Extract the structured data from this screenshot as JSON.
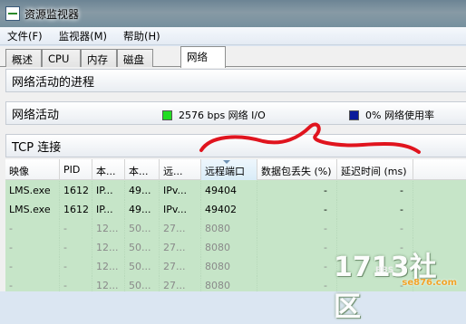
{
  "window": {
    "title": "资源监视器"
  },
  "menu": [
    {
      "label": "文件(F)"
    },
    {
      "label": "监视器(M)"
    },
    {
      "label": "帮助(H)"
    }
  ],
  "tabs": [
    {
      "label": "概述"
    },
    {
      "label": "CPU"
    },
    {
      "label": "内存"
    },
    {
      "label": "磁盘"
    },
    {
      "label": "网络",
      "active": true
    }
  ],
  "sections": {
    "processes": {
      "title": "网络活动的进程"
    },
    "activity": {
      "title": "网络活动",
      "io_legend": "2576 bps 网络 I/O",
      "usage_legend": "0% 网络使用率",
      "io_color": "#22dd22",
      "usage_color": "#0a1a9a"
    },
    "tcp": {
      "title": "TCP 连接"
    }
  },
  "tcp_table": {
    "columns": [
      "映像",
      "PID",
      "本...",
      "本...",
      "远...",
      "远程端口",
      "数据包丢失 (%)",
      "延迟时间 (ms)"
    ],
    "sorted_column": "远程端口",
    "rows": [
      [
        "LMS.exe",
        "1612",
        "IP...",
        "49...",
        "IPv...",
        "49404",
        "-",
        "-"
      ],
      [
        "LMS.exe",
        "1612",
        "IP...",
        "49...",
        "IPv...",
        "49402",
        "-",
        "-"
      ],
      [
        "-",
        "-",
        "12...",
        "50...",
        "27...",
        "8080",
        "-",
        "-"
      ],
      [
        "-",
        "-",
        "12...",
        "50...",
        "27...",
        "8080",
        "-",
        "-"
      ],
      [
        "-",
        "-",
        "12...",
        "50...",
        "27...",
        "8080",
        "-",
        "-"
      ],
      [
        "-",
        "-",
        "12...",
        "50...",
        "27...",
        "8080",
        "-",
        "-"
      ]
    ]
  },
  "watermark": {
    "main": "1713社区",
    "sub": "se876.com",
    "bbs": "BBS"
  },
  "annotation_color": "#e0141e"
}
